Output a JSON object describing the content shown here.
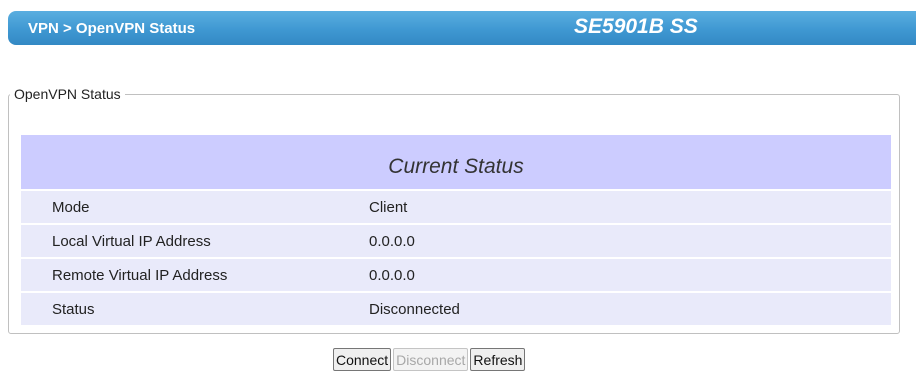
{
  "header": {
    "breadcrumb": "VPN > OpenVPN Status",
    "model": "SE5901B SS",
    "color": "#3f98d2"
  },
  "status_group": {
    "legend": "OpenVPN Status",
    "table_title": "Current Status",
    "rows": [
      {
        "label": "Mode",
        "value": "Client"
      },
      {
        "label": "Local Virtual IP Address",
        "value": "0.0.0.0"
      },
      {
        "label": "Remote Virtual IP Address",
        "value": "0.0.0.0"
      },
      {
        "label": "Status",
        "value": "Disconnected"
      }
    ]
  },
  "buttons": {
    "connect": "Connect",
    "disconnect": "Disconnect",
    "refresh": "Refresh"
  }
}
